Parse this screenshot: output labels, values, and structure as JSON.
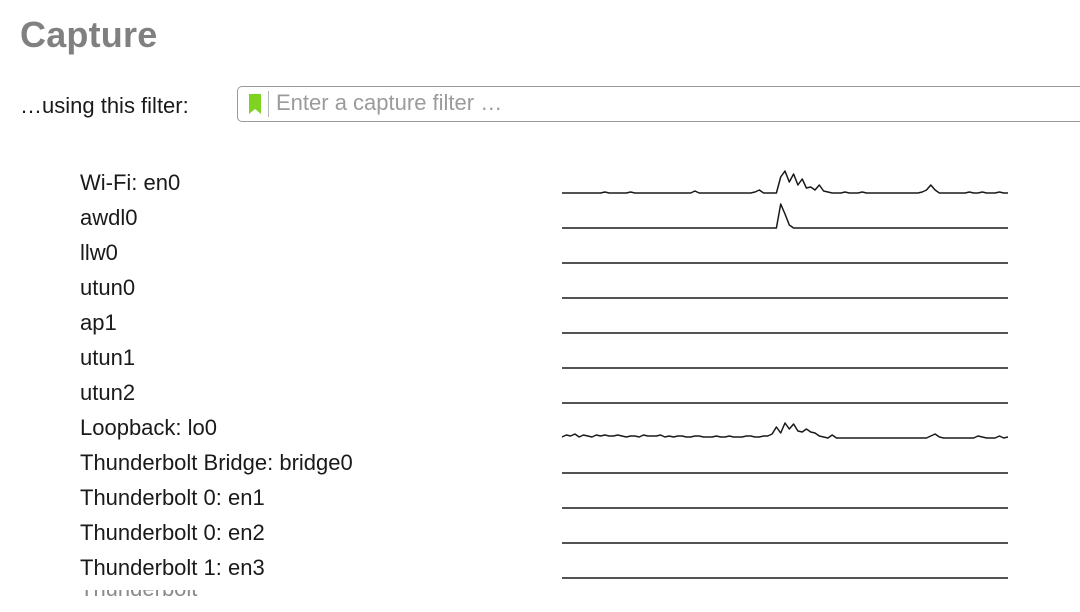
{
  "capture": {
    "title": "Capture",
    "filter": {
      "label": "…using this filter:",
      "placeholder": "Enter a capture filter …",
      "value": "",
      "bookmark_icon": "bookmark-icon",
      "bookmark_color": "#7ed321"
    },
    "interfaces": [
      {
        "name": "Wi-Fi: en0",
        "traffic": [
          0,
          0,
          0,
          0,
          0,
          0,
          0,
          0,
          0,
          0,
          1,
          0,
          0,
          0,
          0,
          0,
          1,
          0,
          0,
          0,
          0,
          0,
          0,
          0,
          0,
          0,
          0,
          0,
          0,
          0,
          0,
          2,
          0,
          0,
          0,
          0,
          0,
          0,
          0,
          0,
          0,
          0,
          0,
          0,
          0,
          1,
          3,
          0,
          0,
          0,
          0,
          16,
          22,
          11,
          19,
          8,
          14,
          5,
          6,
          3,
          8,
          2,
          1,
          0,
          0,
          0,
          1,
          0,
          0,
          0,
          1,
          0,
          0,
          0,
          0,
          0,
          0,
          0,
          0,
          0,
          0,
          0,
          0,
          0,
          1,
          3,
          8,
          3,
          0,
          0,
          0,
          0,
          0,
          0,
          0,
          1,
          0,
          0,
          1,
          0,
          0,
          0,
          1,
          0,
          0
        ]
      },
      {
        "name": "awdl0",
        "traffic": [
          0,
          0,
          0,
          0,
          0,
          0,
          0,
          0,
          0,
          0,
          0,
          0,
          0,
          0,
          0,
          0,
          0,
          0,
          0,
          0,
          0,
          0,
          0,
          0,
          0,
          0,
          0,
          0,
          0,
          0,
          0,
          0,
          0,
          0,
          0,
          0,
          0,
          0,
          0,
          0,
          0,
          0,
          0,
          0,
          0,
          0,
          0,
          0,
          0,
          0,
          0,
          24,
          14,
          3,
          0,
          0,
          0,
          0,
          0,
          0,
          0,
          0,
          0,
          0,
          0,
          0,
          0,
          0,
          0,
          0,
          0,
          0,
          0,
          0,
          0,
          0,
          0,
          0,
          0,
          0,
          0,
          0,
          0,
          0,
          0,
          0,
          0,
          0,
          0,
          0,
          0,
          0,
          0,
          0,
          0,
          0,
          0,
          0,
          0,
          0,
          0,
          0,
          0,
          0,
          0
        ]
      },
      {
        "name": "llw0",
        "traffic": [
          0,
          0,
          0,
          0,
          0,
          0,
          0,
          0,
          0,
          0,
          0,
          0,
          0,
          0,
          0,
          0,
          0,
          0,
          0,
          0,
          0,
          0,
          0,
          0,
          0,
          0,
          0,
          0,
          0,
          0,
          0,
          0,
          0,
          0,
          0,
          0,
          0,
          0,
          0,
          0,
          0,
          0,
          0,
          0,
          0,
          0,
          0,
          0,
          0,
          0,
          0,
          0,
          0,
          0,
          0,
          0,
          0,
          0,
          0,
          0,
          0,
          0,
          0,
          0,
          0,
          0,
          0,
          0,
          0,
          0,
          0,
          0,
          0,
          0,
          0,
          0,
          0,
          0,
          0,
          0,
          0,
          0,
          0,
          0,
          0,
          0,
          0,
          0,
          0,
          0,
          0,
          0,
          0,
          0,
          0,
          0,
          0,
          0,
          0,
          0,
          0,
          0,
          0,
          0,
          0
        ]
      },
      {
        "name": "utun0",
        "traffic": [
          0,
          0,
          0,
          0,
          0,
          0,
          0,
          0,
          0,
          0,
          0,
          0,
          0,
          0,
          0,
          0,
          0,
          0,
          0,
          0,
          0,
          0,
          0,
          0,
          0,
          0,
          0,
          0,
          0,
          0,
          0,
          0,
          0,
          0,
          0,
          0,
          0,
          0,
          0,
          0,
          0,
          0,
          0,
          0,
          0,
          0,
          0,
          0,
          0,
          0,
          0,
          0,
          0,
          0,
          0,
          0,
          0,
          0,
          0,
          0,
          0,
          0,
          0,
          0,
          0,
          0,
          0,
          0,
          0,
          0,
          0,
          0,
          0,
          0,
          0,
          0,
          0,
          0,
          0,
          0,
          0,
          0,
          0,
          0,
          0,
          0,
          0,
          0,
          0,
          0,
          0,
          0,
          0,
          0,
          0,
          0,
          0,
          0,
          0,
          0,
          0,
          0,
          0,
          0,
          0
        ]
      },
      {
        "name": "ap1",
        "traffic": [
          0,
          0,
          0,
          0,
          0,
          0,
          0,
          0,
          0,
          0,
          0,
          0,
          0,
          0,
          0,
          0,
          0,
          0,
          0,
          0,
          0,
          0,
          0,
          0,
          0,
          0,
          0,
          0,
          0,
          0,
          0,
          0,
          0,
          0,
          0,
          0,
          0,
          0,
          0,
          0,
          0,
          0,
          0,
          0,
          0,
          0,
          0,
          0,
          0,
          0,
          0,
          0,
          0,
          0,
          0,
          0,
          0,
          0,
          0,
          0,
          0,
          0,
          0,
          0,
          0,
          0,
          0,
          0,
          0,
          0,
          0,
          0,
          0,
          0,
          0,
          0,
          0,
          0,
          0,
          0,
          0,
          0,
          0,
          0,
          0,
          0,
          0,
          0,
          0,
          0,
          0,
          0,
          0,
          0,
          0,
          0,
          0,
          0,
          0,
          0,
          0,
          0,
          0,
          0,
          0
        ]
      },
      {
        "name": "utun1",
        "traffic": [
          0,
          0,
          0,
          0,
          0,
          0,
          0,
          0,
          0,
          0,
          0,
          0,
          0,
          0,
          0,
          0,
          0,
          0,
          0,
          0,
          0,
          0,
          0,
          0,
          0,
          0,
          0,
          0,
          0,
          0,
          0,
          0,
          0,
          0,
          0,
          0,
          0,
          0,
          0,
          0,
          0,
          0,
          0,
          0,
          0,
          0,
          0,
          0,
          0,
          0,
          0,
          0,
          0,
          0,
          0,
          0,
          0,
          0,
          0,
          0,
          0,
          0,
          0,
          0,
          0,
          0,
          0,
          0,
          0,
          0,
          0,
          0,
          0,
          0,
          0,
          0,
          0,
          0,
          0,
          0,
          0,
          0,
          0,
          0,
          0,
          0,
          0,
          0,
          0,
          0,
          0,
          0,
          0,
          0,
          0,
          0,
          0,
          0,
          0,
          0,
          0,
          0,
          0,
          0,
          0
        ]
      },
      {
        "name": "utun2",
        "traffic": [
          0,
          0,
          0,
          0,
          0,
          0,
          0,
          0,
          0,
          0,
          0,
          0,
          0,
          0,
          0,
          0,
          0,
          0,
          0,
          0,
          0,
          0,
          0,
          0,
          0,
          0,
          0,
          0,
          0,
          0,
          0,
          0,
          0,
          0,
          0,
          0,
          0,
          0,
          0,
          0,
          0,
          0,
          0,
          0,
          0,
          0,
          0,
          0,
          0,
          0,
          0,
          0,
          0,
          0,
          0,
          0,
          0,
          0,
          0,
          0,
          0,
          0,
          0,
          0,
          0,
          0,
          0,
          0,
          0,
          0,
          0,
          0,
          0,
          0,
          0,
          0,
          0,
          0,
          0,
          0,
          0,
          0,
          0,
          0,
          0,
          0,
          0,
          0,
          0,
          0,
          0,
          0,
          0,
          0,
          0,
          0,
          0,
          0,
          0,
          0,
          0,
          0,
          0,
          0,
          0
        ]
      },
      {
        "name": "Loopback: lo0",
        "traffic": [
          1,
          3,
          2,
          4,
          1,
          3,
          2,
          1,
          3,
          2,
          3,
          2,
          2,
          3,
          2,
          1,
          2,
          2,
          1,
          3,
          2,
          2,
          2,
          3,
          1,
          2,
          1,
          2,
          2,
          1,
          1,
          2,
          2,
          1,
          1,
          1,
          2,
          1,
          1,
          2,
          1,
          1,
          1,
          2,
          2,
          1,
          1,
          2,
          2,
          4,
          11,
          5,
          15,
          9,
          14,
          7,
          6,
          9,
          6,
          5,
          2,
          1,
          0,
          3,
          0,
          0,
          0,
          0,
          0,
          0,
          0,
          0,
          0,
          0,
          0,
          0,
          0,
          0,
          0,
          0,
          0,
          0,
          0,
          0,
          0,
          0,
          2,
          4,
          1,
          0,
          0,
          0,
          0,
          0,
          0,
          0,
          0,
          2,
          1,
          0,
          0,
          0,
          2,
          0,
          1
        ]
      },
      {
        "name": "Thunderbolt Bridge: bridge0",
        "traffic": [
          0,
          0,
          0,
          0,
          0,
          0,
          0,
          0,
          0,
          0,
          0,
          0,
          0,
          0,
          0,
          0,
          0,
          0,
          0,
          0,
          0,
          0,
          0,
          0,
          0,
          0,
          0,
          0,
          0,
          0,
          0,
          0,
          0,
          0,
          0,
          0,
          0,
          0,
          0,
          0,
          0,
          0,
          0,
          0,
          0,
          0,
          0,
          0,
          0,
          0,
          0,
          0,
          0,
          0,
          0,
          0,
          0,
          0,
          0,
          0,
          0,
          0,
          0,
          0,
          0,
          0,
          0,
          0,
          0,
          0,
          0,
          0,
          0,
          0,
          0,
          0,
          0,
          0,
          0,
          0,
          0,
          0,
          0,
          0,
          0,
          0,
          0,
          0,
          0,
          0,
          0,
          0,
          0,
          0,
          0,
          0,
          0,
          0,
          0,
          0,
          0,
          0,
          0,
          0,
          0
        ]
      },
      {
        "name": "Thunderbolt 0: en1",
        "traffic": [
          0,
          0,
          0,
          0,
          0,
          0,
          0,
          0,
          0,
          0,
          0,
          0,
          0,
          0,
          0,
          0,
          0,
          0,
          0,
          0,
          0,
          0,
          0,
          0,
          0,
          0,
          0,
          0,
          0,
          0,
          0,
          0,
          0,
          0,
          0,
          0,
          0,
          0,
          0,
          0,
          0,
          0,
          0,
          0,
          0,
          0,
          0,
          0,
          0,
          0,
          0,
          0,
          0,
          0,
          0,
          0,
          0,
          0,
          0,
          0,
          0,
          0,
          0,
          0,
          0,
          0,
          0,
          0,
          0,
          0,
          0,
          0,
          0,
          0,
          0,
          0,
          0,
          0,
          0,
          0,
          0,
          0,
          0,
          0,
          0,
          0,
          0,
          0,
          0,
          0,
          0,
          0,
          0,
          0,
          0,
          0,
          0,
          0,
          0,
          0,
          0,
          0,
          0,
          0,
          0
        ]
      },
      {
        "name": "Thunderbolt 0: en2",
        "traffic": [
          0,
          0,
          0,
          0,
          0,
          0,
          0,
          0,
          0,
          0,
          0,
          0,
          0,
          0,
          0,
          0,
          0,
          0,
          0,
          0,
          0,
          0,
          0,
          0,
          0,
          0,
          0,
          0,
          0,
          0,
          0,
          0,
          0,
          0,
          0,
          0,
          0,
          0,
          0,
          0,
          0,
          0,
          0,
          0,
          0,
          0,
          0,
          0,
          0,
          0,
          0,
          0,
          0,
          0,
          0,
          0,
          0,
          0,
          0,
          0,
          0,
          0,
          0,
          0,
          0,
          0,
          0,
          0,
          0,
          0,
          0,
          0,
          0,
          0,
          0,
          0,
          0,
          0,
          0,
          0,
          0,
          0,
          0,
          0,
          0,
          0,
          0,
          0,
          0,
          0,
          0,
          0,
          0,
          0,
          0,
          0,
          0,
          0,
          0,
          0,
          0,
          0,
          0,
          0,
          0
        ]
      },
      {
        "name": "Thunderbolt 1: en3",
        "traffic": [
          0,
          0,
          0,
          0,
          0,
          0,
          0,
          0,
          0,
          0,
          0,
          0,
          0,
          0,
          0,
          0,
          0,
          0,
          0,
          0,
          0,
          0,
          0,
          0,
          0,
          0,
          0,
          0,
          0,
          0,
          0,
          0,
          0,
          0,
          0,
          0,
          0,
          0,
          0,
          0,
          0,
          0,
          0,
          0,
          0,
          0,
          0,
          0,
          0,
          0,
          0,
          0,
          0,
          0,
          0,
          0,
          0,
          0,
          0,
          0,
          0,
          0,
          0,
          0,
          0,
          0,
          0,
          0,
          0,
          0,
          0,
          0,
          0,
          0,
          0,
          0,
          0,
          0,
          0,
          0,
          0,
          0,
          0,
          0,
          0,
          0,
          0,
          0,
          0,
          0,
          0,
          0,
          0,
          0,
          0,
          0,
          0,
          0,
          0,
          0,
          0,
          0,
          0,
          0,
          0
        ]
      }
    ]
  }
}
